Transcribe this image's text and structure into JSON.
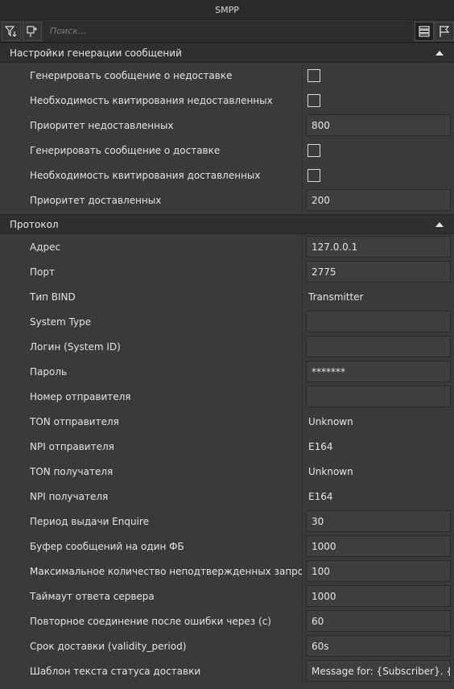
{
  "window": {
    "title": "SMPP"
  },
  "toolbar": {
    "search_placeholder": "Поиск...",
    "buttons": [
      "filter-icon",
      "pin-icon",
      "list-view-icon",
      "flag-icon"
    ]
  },
  "sections": [
    {
      "title": "Настройки генерации сообщений",
      "rows": [
        {
          "label": "Генерировать сообщение о недоставке",
          "type": "checkbox",
          "checked": false
        },
        {
          "label": "Необходимость квитирования недоставленных",
          "type": "checkbox",
          "checked": false
        },
        {
          "label": "Приоритет недоставленных",
          "type": "field",
          "value": "800"
        },
        {
          "label": "Генерировать сообщение о доставке",
          "type": "checkbox",
          "checked": false
        },
        {
          "label": "Необходимость квитирования доставленных",
          "type": "checkbox",
          "checked": false
        },
        {
          "label": "Приоритет доставленных",
          "type": "field",
          "value": "200"
        }
      ]
    },
    {
      "title": "Протокол",
      "rows": [
        {
          "label": "Адрес",
          "type": "field",
          "value": "127.0.0.1"
        },
        {
          "label": "Порт",
          "type": "field",
          "value": "2775"
        },
        {
          "label": "Тип BIND",
          "type": "plain",
          "value": "Transmitter"
        },
        {
          "label": "System Type",
          "type": "field",
          "value": ""
        },
        {
          "label": "Логин (System ID)",
          "type": "field",
          "value": ""
        },
        {
          "label": "Пароль",
          "type": "field",
          "value": "*******"
        },
        {
          "label": "Номер отправителя",
          "type": "field",
          "value": ""
        },
        {
          "label": "TON отправителя",
          "type": "plain",
          "value": "Unknown"
        },
        {
          "label": "NPI отправителя",
          "type": "plain",
          "value": "E164"
        },
        {
          "label": "TON получателя",
          "type": "plain",
          "value": "Unknown"
        },
        {
          "label": "NPI получателя",
          "type": "plain",
          "value": "E164"
        },
        {
          "label": "Период выдачи Enquire",
          "type": "field",
          "value": "30"
        },
        {
          "label": "Буфер сообщений на один ФБ",
          "type": "field",
          "value": "1000"
        },
        {
          "label": "Максимальное количество неподтвержденных запросов",
          "type": "field",
          "value": "100"
        },
        {
          "label": "Таймаут ответа сервера",
          "type": "field",
          "value": "1000"
        },
        {
          "label": "Повторное соединение после ошибки через (с)",
          "type": "field",
          "value": "60"
        },
        {
          "label": "Срок доставки (validity_period)",
          "type": "field",
          "value": "60s"
        },
        {
          "label": "Шаблон текста статуса доставки",
          "type": "field",
          "value": "Message for: {Subscriber}. {Statu"
        }
      ]
    }
  ]
}
